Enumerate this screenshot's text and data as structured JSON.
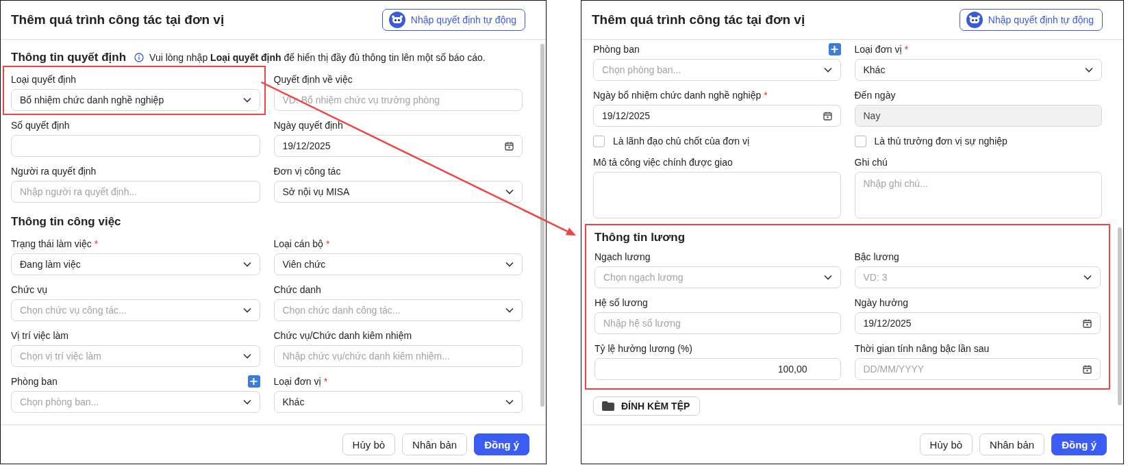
{
  "dialogs": [
    {
      "title": "Thêm quá trình công tác tại đơn vị",
      "auto_button": "Nhập quyết định tự động",
      "sections": [
        {
          "heading": "Thông tin quyết định",
          "note": "Vui lòng nhập **Loại quyết định** để hiển thị đầy đủ thông tin lên một số báo cáo.",
          "fields": [
            {
              "kind": "select",
              "label": "Loại quyết định",
              "value": "Bổ nhiệm chức danh nghề nghiệp",
              "highlighted": true
            },
            {
              "kind": "text",
              "label": "Quyết định về việc",
              "placeholder": "VD: Bổ nhiệm chức vụ trưởng phòng"
            },
            {
              "kind": "text",
              "label": "Số quyết định"
            },
            {
              "kind": "date",
              "label": "Ngày quyết định",
              "value": "19/12/2025"
            },
            {
              "kind": "text",
              "label": "Người ra quyết định",
              "placeholder": "Nhập người ra quyết định..."
            },
            {
              "kind": "select",
              "label": "Đơn vị công tác",
              "value": "Sở nội vụ MISA"
            }
          ]
        },
        {
          "heading": "Thông tin công việc",
          "fields": [
            {
              "kind": "select",
              "label": "Trạng thái làm việc",
              "required_mark": "*",
              "value": "Đang làm việc"
            },
            {
              "kind": "select",
              "label": "Loại cán bộ",
              "required_mark": "*",
              "value": "Viên chức"
            },
            {
              "kind": "select",
              "label": "Chức vụ",
              "placeholder": "Chọn chức vụ công tác..."
            },
            {
              "kind": "select",
              "label": "Chức danh",
              "placeholder": "Chọn chức danh công tác..."
            },
            {
              "kind": "select",
              "label": "Vị trí việc làm",
              "placeholder": "Chọn vị trí việc làm"
            },
            {
              "kind": "text",
              "label": "Chức vụ/Chức danh kiêm nhiệm",
              "placeholder": "Nhập chức vụ/chức danh kiêm nhiệm..."
            },
            {
              "kind": "select",
              "label": "Phòng ban",
              "add_button": "+",
              "placeholder": "Chọn phòng ban..."
            },
            {
              "kind": "select",
              "label": "Loại đơn vị",
              "required_mark": "*",
              "value": "Khác"
            }
          ]
        }
      ],
      "footer_buttons": [
        {
          "label": "Hủy bỏ",
          "kind": "secondary"
        },
        {
          "label": "Nhân bản",
          "kind": "secondary"
        },
        {
          "label": "Đồng ý",
          "kind": "primary"
        }
      ]
    },
    {
      "title": "Thêm quá trình công tác tại đơn vị",
      "auto_button": "Nhập quyết định tự động",
      "sections": [
        {
          "fields": [
            {
              "kind": "select",
              "label": "Phòng ban",
              "add_button": "+",
              "placeholder": "Chọn phòng ban..."
            },
            {
              "kind": "select",
              "label": "Loại đơn vị",
              "required_mark": "*",
              "value": "Khác"
            },
            {
              "kind": "date",
              "label": "Ngày bổ nhiệm chức danh nghề nghiệp",
              "required_mark": "*",
              "value": "19/12/2025"
            },
            {
              "kind": "readonly",
              "label": "Đến ngày",
              "value": "Nay"
            },
            {
              "kind": "checkbox",
              "label": "Là lãnh đạo chủ chốt của đơn vị",
              "checked": false
            },
            {
              "kind": "checkbox",
              "label": "Là thủ trưởng đơn vị sự nghiệp",
              "checked": false
            },
            {
              "kind": "textarea",
              "label": "Mô tả công việc chính được giao"
            },
            {
              "kind": "textarea",
              "label": "Ghi chú",
              "placeholder": "Nhập ghi chú..."
            }
          ]
        },
        {
          "heading": "Thông tin lương",
          "highlighted": true,
          "fields": [
            {
              "kind": "select",
              "label": "Ngạch lương",
              "placeholder": "Chọn ngạch lương"
            },
            {
              "kind": "select",
              "label": "Bậc lương",
              "placeholder": "VD: 3"
            },
            {
              "kind": "text",
              "label": "Hệ số lương",
              "placeholder": "Nhập hệ số lương"
            },
            {
              "kind": "date",
              "label": "Ngày hưởng",
              "value": "19/12/2025"
            },
            {
              "kind": "number",
              "label": "Tỷ lệ hưởng lương (%)",
              "value": "100,00"
            },
            {
              "kind": "date",
              "label": "Thời gian tính nâng bậc lần sau",
              "placeholder": "DD/MM/YYYY"
            }
          ]
        }
      ],
      "attach_button": "ĐÍNH KÈM TỆP",
      "footer_buttons": [
        {
          "label": "Hủy bỏ",
          "kind": "secondary"
        },
        {
          "label": "Nhân bản",
          "kind": "secondary"
        },
        {
          "label": "Đồng ý",
          "kind": "primary"
        }
      ]
    }
  ],
  "connector_arrow": true
}
